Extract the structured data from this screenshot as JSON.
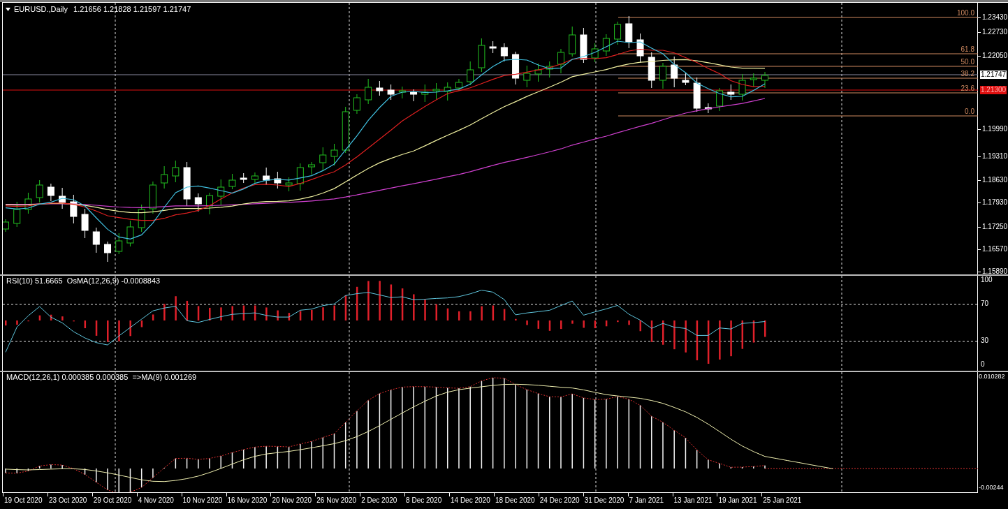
{
  "header": {
    "symbol": "EURUSD.,Daily",
    "ohlc": "1.21656 1.21828 1.21597 1.21747"
  },
  "main_pane": {
    "price_axis": [
      "1.23430",
      "1.22730",
      "1.22050",
      "1.19990",
      "1.19310",
      "1.18630",
      "1.17930",
      "1.17250",
      "1.16570",
      "1.15890"
    ],
    "current_price": "1.21747",
    "line_price": "1.21300",
    "fib_levels": [
      {
        "label": "100.0"
      },
      {
        "label": "61.8"
      },
      {
        "label": "50.0"
      },
      {
        "label": "38.2"
      },
      {
        "label": "23.6"
      },
      {
        "label": "0.0"
      }
    ]
  },
  "rsi_pane": {
    "legend": "RSI(10) 51.6665  OsMA(12,26,9) -0.0008843",
    "axis": [
      "100",
      "70",
      "30",
      "0"
    ]
  },
  "macd_pane": {
    "legend": "MACD(12,26,1) 0.000385 0.000385  =>MA(9) 0.001269",
    "axis": [
      "0.010282",
      "-0.00244"
    ]
  },
  "time_axis": [
    "19 Oct 2020",
    "23 Oct 2020",
    "29 Oct 2020",
    "4 Nov 2020",
    "10 Nov 2020",
    "16 Nov 2020",
    "20 Nov 2020",
    "26 Nov 2020",
    "2 Dec 2020",
    "8 Dec 2020",
    "14 Dec 2020",
    "18 Dec 2020",
    "24 Dec 2020",
    "31 Dec 2020",
    "7 Jan 2021",
    "13 Jan 2021",
    "19 Jan 2021",
    "25 Jan 2021"
  ]
}
